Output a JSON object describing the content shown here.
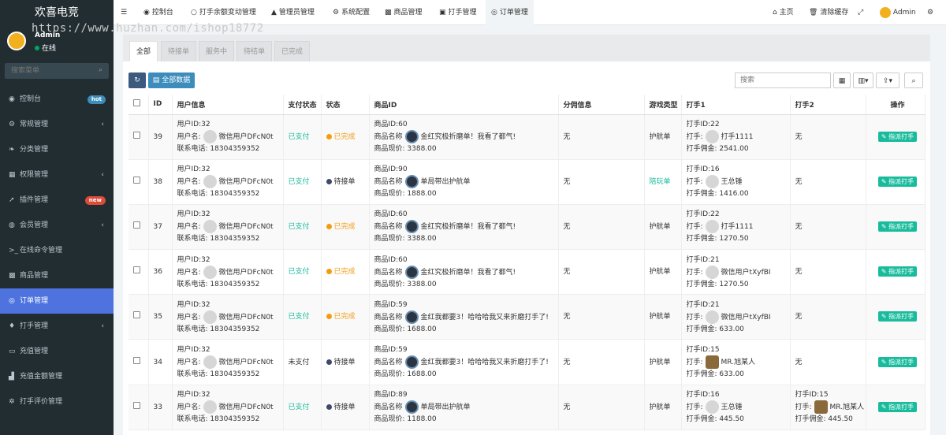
{
  "app": {
    "title": "欢喜电竞",
    "watermark": "https://www.huzhan.com/ishop18772"
  },
  "user": {
    "name": "Admin",
    "status": "在线"
  },
  "sidebar": {
    "search_placeholder": "搜索菜单",
    "items": [
      {
        "label": "控制台",
        "icon": "dashboard-icon",
        "glyph": "◉",
        "badge": "hot",
        "badge_color": "#3c8dbc"
      },
      {
        "label": "常规管理",
        "icon": "cogs-icon",
        "glyph": "⚙",
        "chevron": true
      },
      {
        "label": "分类管理",
        "icon": "leaf-icon",
        "glyph": "❧"
      },
      {
        "label": "权限管理",
        "icon": "group-icon",
        "glyph": "▦",
        "chevron": true
      },
      {
        "label": "插件管理",
        "icon": "rocket-icon",
        "glyph": "➚",
        "badge": "new",
        "badge_color": "#dd4b39"
      },
      {
        "label": "会员管理",
        "icon": "user-circle-icon",
        "glyph": "◍",
        "chevron": true
      },
      {
        "label": "在线命令管理",
        "icon": "terminal-icon",
        "glyph": ">_"
      },
      {
        "label": "商品管理",
        "icon": "cubes-icon",
        "glyph": "▩"
      },
      {
        "label": "订单管理",
        "icon": "eye-icon",
        "glyph": "◎",
        "active": true
      },
      {
        "label": "打手管理",
        "icon": "map-marker-icon",
        "glyph": "♦",
        "chevron": true
      },
      {
        "label": "充值管理",
        "icon": "keyboard-icon",
        "glyph": "▭"
      },
      {
        "label": "充值金额管理",
        "icon": "chart-icon",
        "glyph": "▟"
      },
      {
        "label": "打手评价管理",
        "icon": "cog-icon",
        "glyph": "✲"
      }
    ]
  },
  "topbar": {
    "tabs": [
      {
        "label": "控制台",
        "glyph": "◉"
      },
      {
        "label": "打手余额变动管理",
        "glyph": "○"
      },
      {
        "label": "管理员管理",
        "glyph": "▲"
      },
      {
        "label": "系统配置",
        "glyph": "⚙"
      },
      {
        "label": "商品管理",
        "glyph": "▩"
      },
      {
        "label": "打手管理",
        "glyph": "▣"
      },
      {
        "label": "订单管理",
        "glyph": "◎",
        "active": true
      }
    ],
    "home": "主页",
    "clear_cache": "清除缓存",
    "admin": "Admin"
  },
  "subtabs": [
    "全部",
    "待接单",
    "服务中",
    "待结单",
    "已完成"
  ],
  "toolbar": {
    "all_data": "全部数据",
    "search_placeholder": "搜索"
  },
  "table": {
    "headers": [
      "ID",
      "用户信息",
      "支付状态",
      "状态",
      "商品ID",
      "分佣信息",
      "游戏类型",
      "打手1",
      "打手2",
      "操作"
    ],
    "rows": [
      {
        "id": "39",
        "uid": "用户ID:32",
        "uname": "微信用户DFcN0t",
        "phone": "18304359352",
        "pay": "已支付",
        "status": "已完成",
        "gid": "商品ID:60",
        "gname": "金红究极折磨单！我看了都气!",
        "gprice": "3388.00",
        "commission": "无",
        "game": "护航单",
        "d1id": "打手ID:22",
        "d1name": "打手1111",
        "d1fee": "2541.00",
        "d1av": "user",
        "d2": "无",
        "action": "指派打手"
      },
      {
        "id": "38",
        "uid": "用户ID:32",
        "uname": "微信用户DFcN0t",
        "phone": "18304359352",
        "pay": "已支付",
        "status": "待接单",
        "gid": "商品ID:90",
        "gname": "单局带出护航单",
        "gprice": "1888.00",
        "commission": "无",
        "game": "陪玩单",
        "d1id": "打手ID:16",
        "d1name": "王总锤",
        "d1fee": "1416.00",
        "d1av": "user",
        "d2": "无",
        "action": "指派打手"
      },
      {
        "id": "37",
        "uid": "用户ID:32",
        "uname": "微信用户DFcN0t",
        "phone": "18304359352",
        "pay": "已支付",
        "status": "已完成",
        "gid": "商品ID:60",
        "gname": "金红究极折磨单！我看了都气!",
        "gprice": "3388.00",
        "commission": "无",
        "game": "护航单",
        "d1id": "打手ID:22",
        "d1name": "打手1111",
        "d1fee": "1270.50",
        "d1av": "user",
        "d2": "无",
        "action": "指派打手"
      },
      {
        "id": "36",
        "uid": "用户ID:32",
        "uname": "微信用户DFcN0t",
        "phone": "18304359352",
        "pay": "已支付",
        "status": "已完成",
        "gid": "商品ID:60",
        "gname": "金红究极折磨单！我看了都气!",
        "gprice": "3388.00",
        "commission": "无",
        "game": "护航单",
        "d1id": "打手ID:21",
        "d1name": "微信用户tXyfBI",
        "d1fee": "1270.50",
        "d1av": "user",
        "d2": "无",
        "action": "指派打手"
      },
      {
        "id": "35",
        "uid": "用户ID:32",
        "uname": "微信用户DFcN0t",
        "phone": "18304359352",
        "pay": "已支付",
        "status": "已完成",
        "gid": "商品ID:59",
        "gname": "金红我都要3！哈哈哈我又来折磨打手了!",
        "gprice": "1688.00",
        "commission": "无",
        "game": "护航单",
        "d1id": "打手ID:21",
        "d1name": "微信用户tXyfBI",
        "d1fee": "633.00",
        "d1av": "user",
        "d2": "无",
        "action": "指派打手"
      },
      {
        "id": "34",
        "uid": "用户ID:32",
        "uname": "微信用户DFcN0t",
        "phone": "18304359352",
        "pay": "未支付",
        "status": "待接单",
        "gid": "商品ID:59",
        "gname": "金红我都要3！哈哈哈我又来折磨打手了!",
        "gprice": "1688.00",
        "commission": "无",
        "game": "护航单",
        "d1id": "打手ID:15",
        "d1name": "MR.旭某人",
        "d1fee": "633.00",
        "d1av": "bear",
        "d2": "无",
        "action": "指派打手"
      },
      {
        "id": "33",
        "uid": "用户ID:32",
        "uname": "微信用户DFcN0t",
        "phone": "18304359352",
        "pay": "已支付",
        "status": "待接单",
        "gid": "商品ID:89",
        "gname": "单局带出护航单",
        "gprice": "1188.00",
        "commission": "无",
        "game": "护航单",
        "d1id": "打手ID:16",
        "d1name": "王总锤",
        "d1fee": "445.50",
        "d1av": "user",
        "d2id": "打手ID:15",
        "d2name": "MR.旭某人",
        "d2fee": "445.50",
        "action": "指派打手"
      }
    ]
  },
  "labels": {
    "uname": "用户名:",
    "phone": "联系电话:",
    "gname": "商品名称",
    "gprice": "商品现价:",
    "d": "打手:",
    "dfee": "打手佣金:"
  },
  "colors": {
    "done": "#f39c12",
    "pending": "#3d4a6b",
    "paid": "#18bc9c",
    "accent": "#4e73df"
  }
}
